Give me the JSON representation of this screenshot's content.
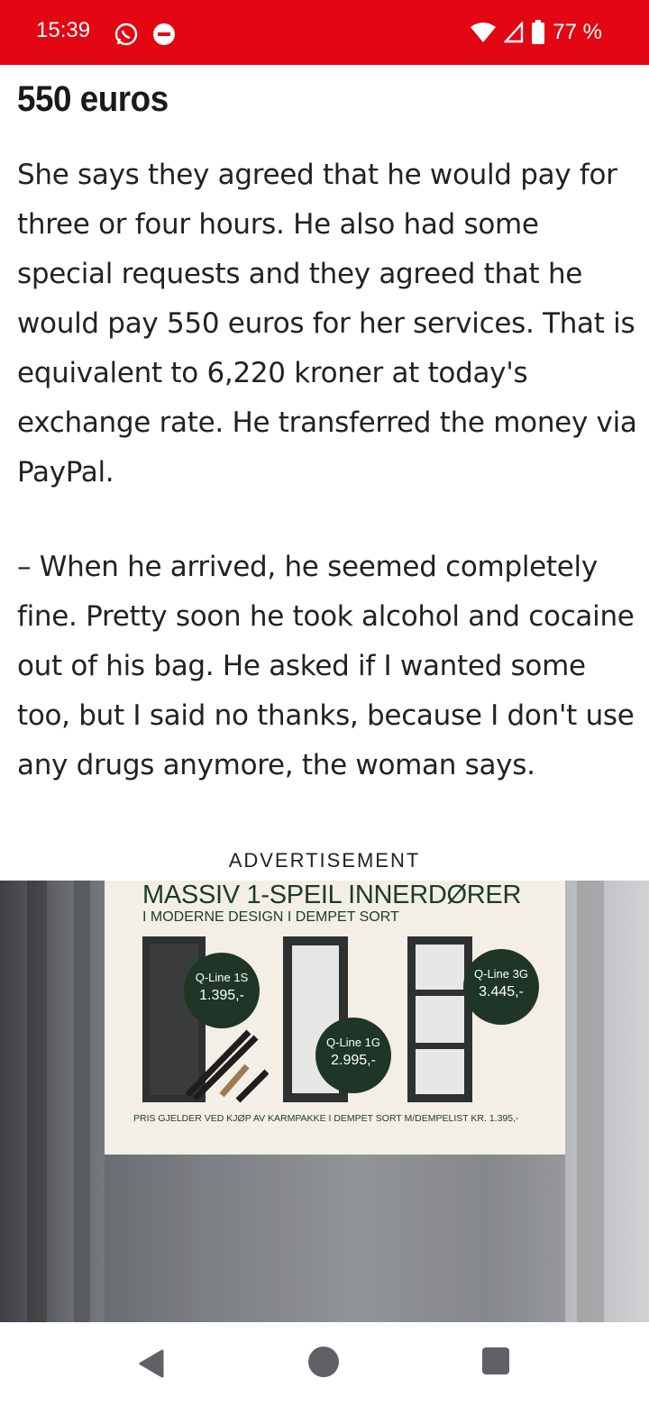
{
  "status_bar": {
    "time": "15:39",
    "battery_percent": "77 %",
    "background_color": "#e30613",
    "icons": [
      "whatsapp-icon",
      "notification-dot-icon",
      "wifi-icon",
      "cell-signal-icon",
      "battery-icon"
    ]
  },
  "article": {
    "heading": "550 euros",
    "paragraph_1": "She says they agreed that he would pay for three or four hours. He also had some special requests and they agreed that he would pay 550 euros for her services. That is equivalent to 6,220 kroner at today's exchange rate. He transferred the money via PayPal.",
    "paragraph_2": "– When he arrived, he seemed completely fine. Pretty soon he took alcohol and cocaine out of his bag. He asked if I wanted some too, but I said no thanks, because I don't use any drugs anymore, the woman says."
  },
  "advertisement": {
    "label": "ADVERTISEMENT",
    "title": "MASSIV 1-SPEIL INNERDØRER",
    "subtitle": "I MODERNE DESIGN I DEMPET SORT",
    "products": [
      {
        "name": "Q-Line 1S",
        "price": "1.395,-"
      },
      {
        "name": "Q-Line 1G",
        "price": "2.995,-"
      },
      {
        "name": "Q-Line 3G",
        "price": "3.445,-"
      }
    ],
    "footer": "PRIS GJELDER VED KJØP AV KARMPAKKE I DEMPET SORT M/DEMPELIST KR. 1.395,-",
    "accent_color": "#1e3527"
  },
  "nav_bar": {
    "icons": [
      "back-icon",
      "home-icon",
      "recent-apps-icon"
    ]
  }
}
